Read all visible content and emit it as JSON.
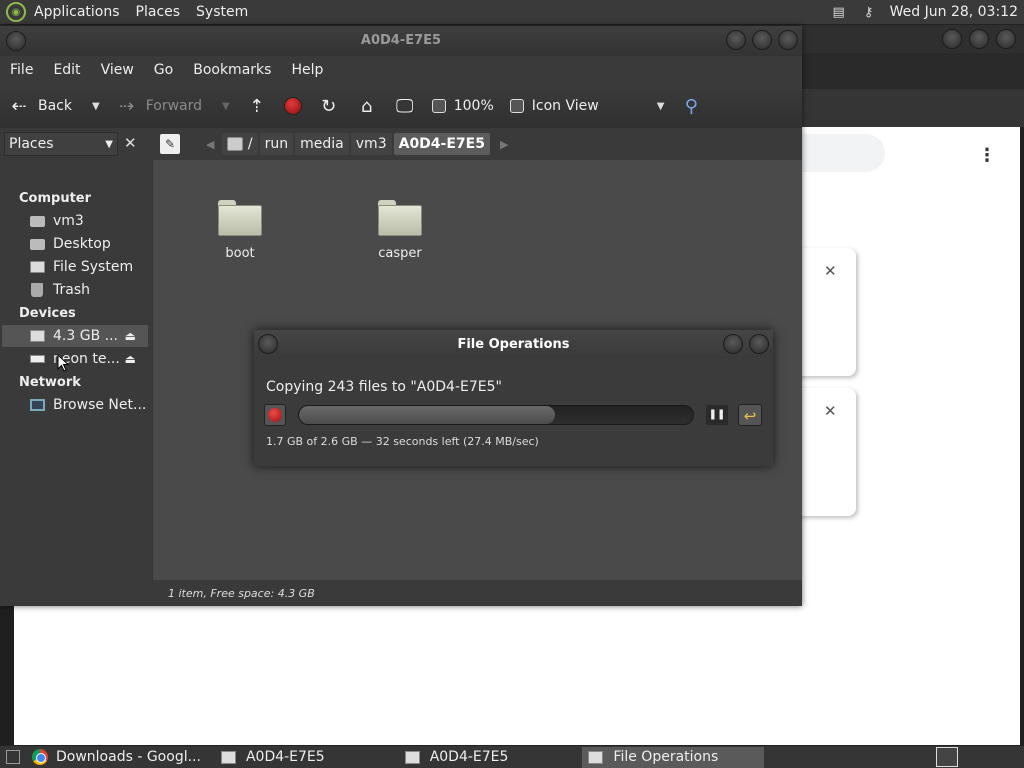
{
  "top_panel": {
    "menus": [
      "Applications",
      "Places",
      "System"
    ],
    "clock": "Wed Jun 28, 03:12"
  },
  "file_manager": {
    "title": "A0D4-E7E5",
    "menu": [
      "File",
      "Edit",
      "View",
      "Go",
      "Bookmarks",
      "Help"
    ],
    "toolbar": {
      "back": "Back",
      "forward": "Forward",
      "zoom": "100%",
      "view_mode": "Icon View"
    },
    "location": {
      "side_pane_selector": "Places",
      "breadcrumbs": [
        "/",
        "run",
        "media",
        "vm3",
        "A0D4-E7E5"
      ]
    },
    "sidebar": {
      "computer_header": "Computer",
      "computer_items": [
        "vm3",
        "Desktop",
        "File System",
        "Trash"
      ],
      "devices_header": "Devices",
      "device_items": [
        "4.3 GB ...",
        "neon te..."
      ],
      "network_header": "Network",
      "network_items": [
        "Browse Net..."
      ]
    },
    "files": [
      "boot",
      "casper"
    ],
    "status": "1 item, Free space: 4.3 GB"
  },
  "file_operations": {
    "title": "File Operations",
    "message": "Copying 243 files to \"A0D4-E7E5\"",
    "progress_fraction": 0.65,
    "detail": "1.7 GB of 2.6 GB — 32 seconds left (27.4 MB/sec)"
  },
  "taskbar": {
    "tasks": [
      "Downloads - Googl...",
      "A0D4-E7E5",
      "A0D4-E7E5",
      "File Operations"
    ]
  },
  "colors": {
    "stop_red": "#d32f2f",
    "undo_yellow": "#e6c24a"
  }
}
